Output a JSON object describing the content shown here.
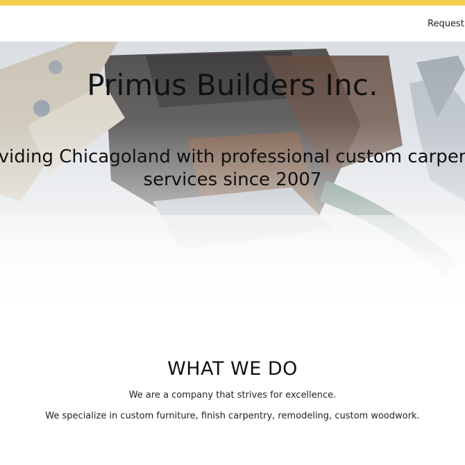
{
  "colors": {
    "accent": "#f6cf4a",
    "text": "#111111",
    "background": "#ffffff"
  },
  "nav": {
    "links": [
      {
        "label": "Request a"
      }
    ]
  },
  "hero": {
    "background": "tools-photo",
    "title": "Primus Builders Inc.",
    "subtitle_line1": "Providing Chicagoland with professional custom carpentry",
    "subtitle_line2": "services since 2007"
  },
  "what_we_do": {
    "heading": "WHAT WE DO",
    "line1": "We are a company that strives for excellence.",
    "line2": "We specialize in custom furniture, finish carpentry, remodeling, custom woodwork."
  }
}
